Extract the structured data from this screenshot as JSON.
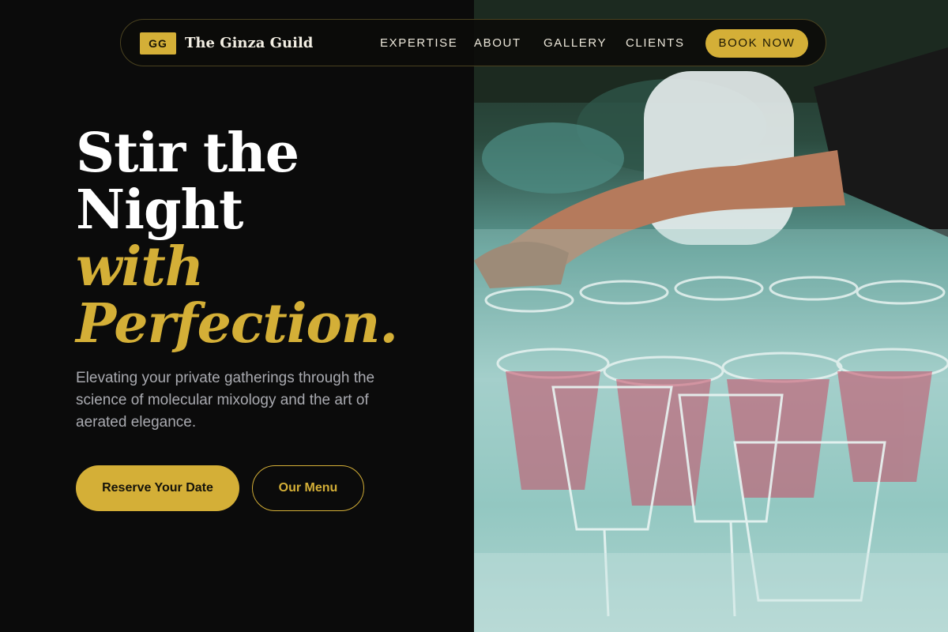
{
  "brand": {
    "badge": "GG",
    "name": "The Ginza Guild"
  },
  "nav": {
    "links": [
      "EXPERTISE",
      "ABOUT",
      "GALLERY",
      "CLIENTS"
    ],
    "cta": "BOOK NOW"
  },
  "hero": {
    "line1": "Stir the",
    "line2": "Night",
    "line3": "with",
    "line4": "Perfection.",
    "subtext": "Elevating your private gatherings through the science of molecular mixology and the art of aerated elegance.",
    "primary_button": "Reserve Your Date",
    "secondary_button": "Our Menu"
  },
  "image": {
    "description_icon": "cocktail-glasses-photo"
  },
  "colors": {
    "accent": "#d4af37",
    "background": "#0b0b0b",
    "text": "#ffffff",
    "muted": "#a9aab0"
  }
}
